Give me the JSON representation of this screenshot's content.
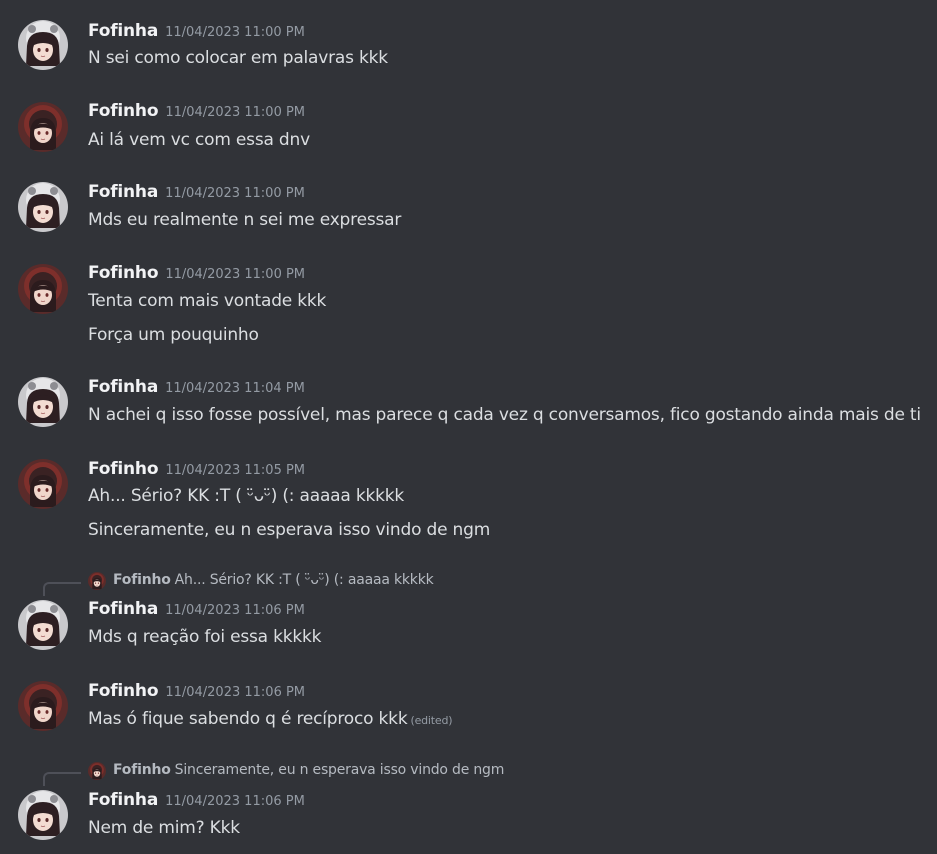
{
  "messages": [
    {
      "author": "Fofinha",
      "avatar": "fofinha",
      "time": "11/04/2023 11:00 PM",
      "lines": [
        "N sei como colocar em palavras kkk"
      ]
    },
    {
      "author": "Fofinho",
      "avatar": "fofinho",
      "time": "11/04/2023 11:00 PM",
      "lines": [
        "Ai lá vem vc com essa dnv"
      ]
    },
    {
      "author": "Fofinha",
      "avatar": "fofinha",
      "time": "11/04/2023 11:00 PM",
      "lines": [
        "Mds eu realmente n sei me expressar"
      ]
    },
    {
      "author": "Fofinho",
      "avatar": "fofinho",
      "time": "11/04/2023 11:00 PM",
      "lines": [
        "Tenta com mais vontade kkk",
        "Força um pouquinho"
      ]
    },
    {
      "author": "Fofinha",
      "avatar": "fofinha",
      "time": "11/04/2023 11:04 PM",
      "lines": [
        "N achei q isso fosse possível, mas parece q cada vez q conversamos, fico gostando ainda mais de ti"
      ]
    },
    {
      "author": "Fofinho",
      "avatar": "fofinho",
      "time": "11/04/2023 11:05 PM",
      "lines": [
        "Ah... Sério? KK :T ( ᵕ̈ᴗᵕ̈) (: aaaaa kkkkk",
        "Sinceramente, eu n esperava isso vindo de ngm"
      ]
    },
    {
      "author": "Fofinha",
      "avatar": "fofinha",
      "time": "11/04/2023 11:06 PM",
      "lines": [
        "Mds q reação foi essa kkkkk"
      ],
      "reply": {
        "author": "Fofinho",
        "avatar": "fofinho",
        "text": "Ah... Sério? KK :T ( ᵕ̈ᴗᵕ̈) (: aaaaa kkkkk"
      }
    },
    {
      "author": "Fofinho",
      "avatar": "fofinho",
      "time": "11/04/2023 11:06 PM",
      "lines": [
        "Mas ó fique sabendo q é recíproco kkk"
      ],
      "edited": "(edited)"
    },
    {
      "author": "Fofinha",
      "avatar": "fofinha",
      "time": "11/04/2023 11:06 PM",
      "lines": [
        "Nem de mim? Kkk"
      ],
      "reply": {
        "author": "Fofinho",
        "avatar": "fofinho",
        "text": "Sinceramente, eu n esperava isso vindo de ngm"
      }
    }
  ],
  "colors": {
    "background": "#313338",
    "author": "#f2f3f5",
    "text": "#dbdee1",
    "muted": "#949ba4"
  }
}
